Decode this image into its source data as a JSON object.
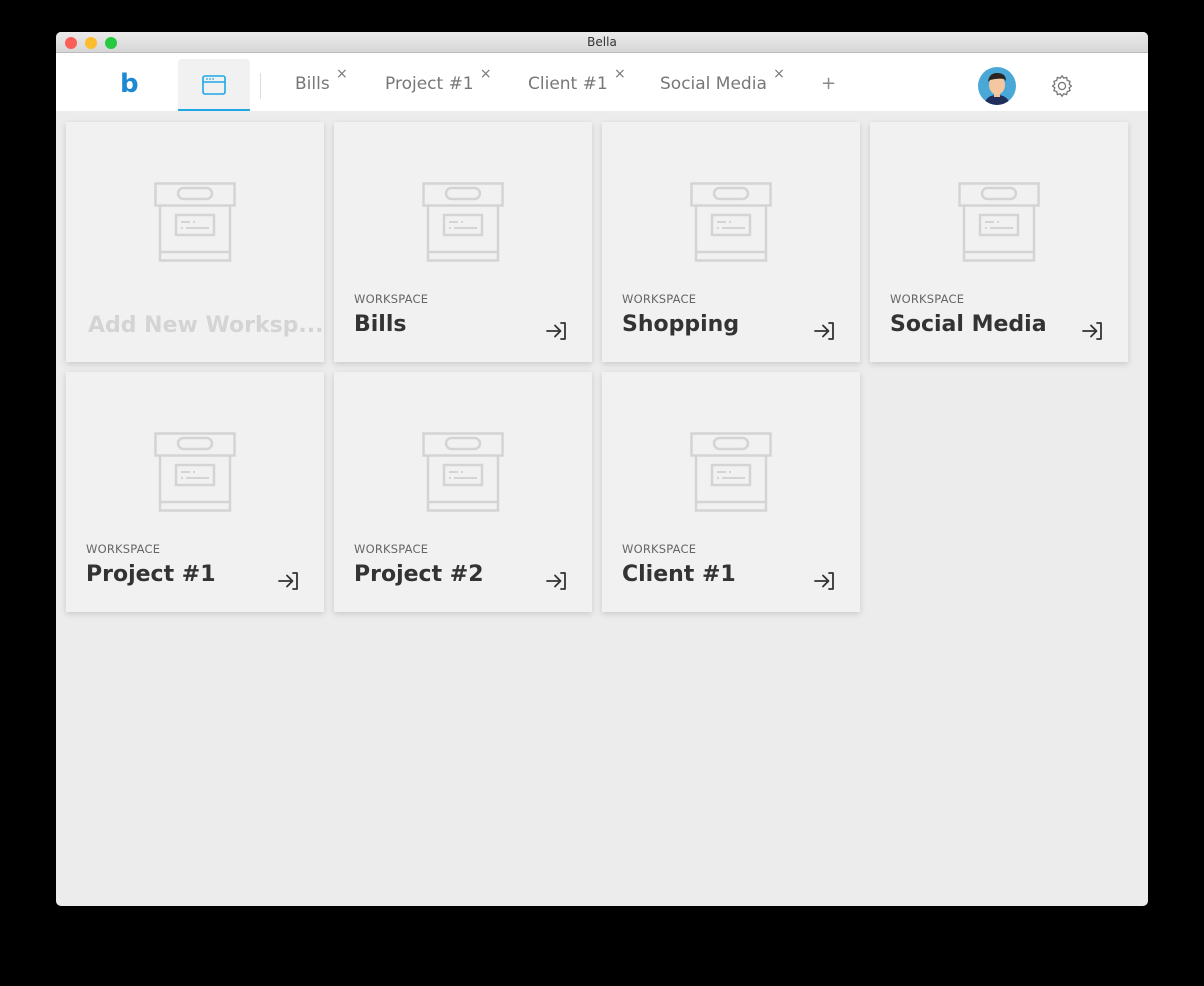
{
  "window": {
    "title": "Bella"
  },
  "header": {
    "logo": "b",
    "tabs": [
      {
        "label": "Bills"
      },
      {
        "label": "Project #1"
      },
      {
        "label": "Client #1"
      },
      {
        "label": "Social Media"
      }
    ],
    "close_glyph": "×",
    "add_tab": "+"
  },
  "add_card": {
    "label": "Add New Worksp..."
  },
  "workspaces": [
    {
      "kind": "WORKSPACE",
      "name": "Bills"
    },
    {
      "kind": "WORKSPACE",
      "name": "Shopping"
    },
    {
      "kind": "WORKSPACE",
      "name": "Social Media"
    },
    {
      "kind": "WORKSPACE",
      "name": "Project #1"
    },
    {
      "kind": "WORKSPACE",
      "name": "Project #2"
    },
    {
      "kind": "WORKSPACE",
      "name": "Client #1"
    }
  ],
  "colors": {
    "accent": "#1ea7e4"
  }
}
